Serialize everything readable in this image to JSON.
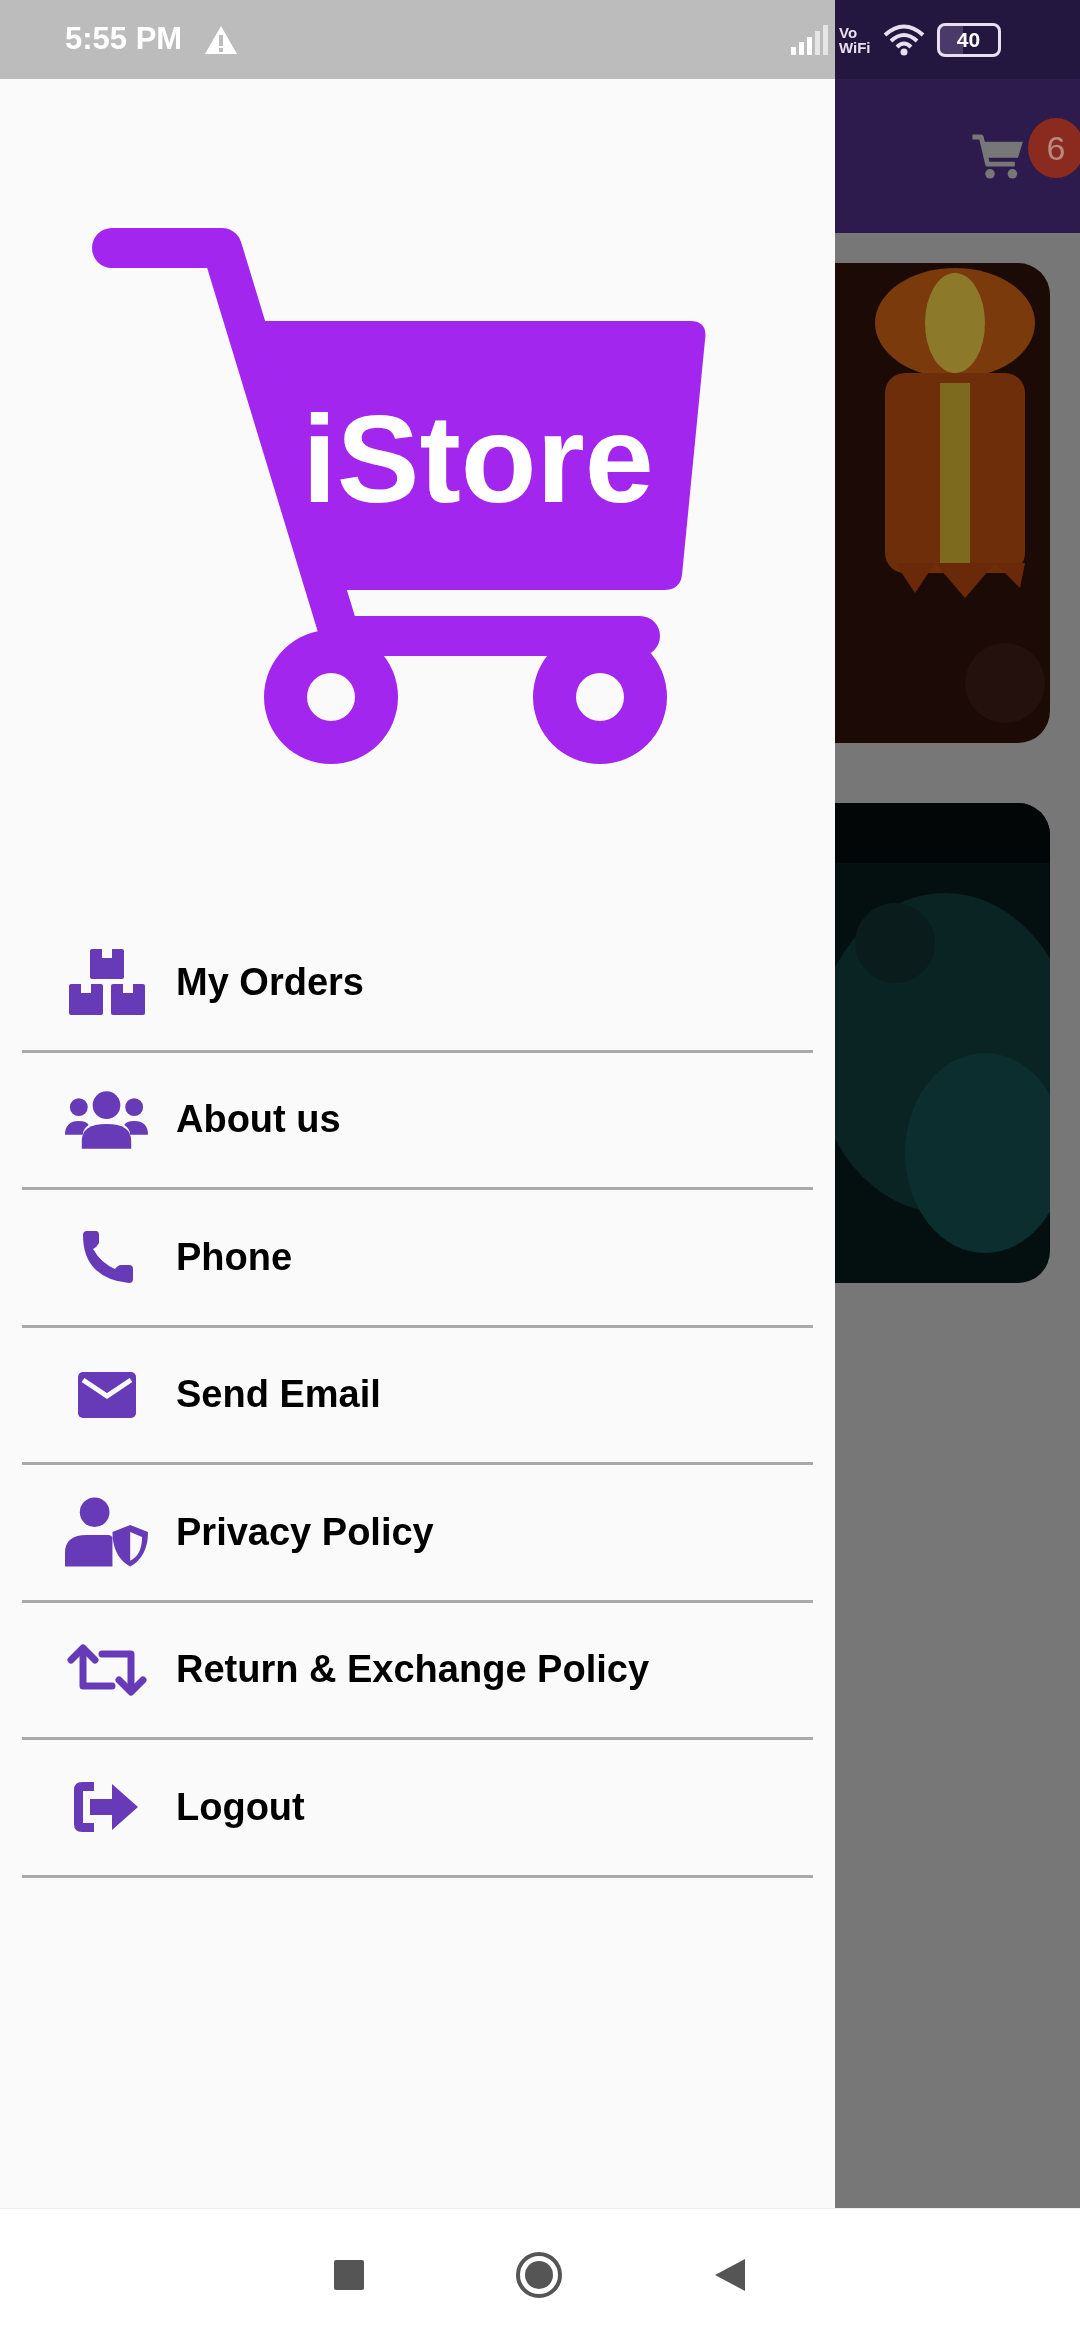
{
  "status_bar": {
    "time": "5:55 PM",
    "vo": "Vo",
    "wifi": "WiFi",
    "battery": "40"
  },
  "app_bar": {
    "cart_badge": "6"
  },
  "drawer": {
    "logo_text": "iStore",
    "items": [
      {
        "label": "My Orders"
      },
      {
        "label": "About us"
      },
      {
        "label": "Phone"
      },
      {
        "label": "Send Email"
      },
      {
        "label": "Privacy Policy"
      },
      {
        "label": "Return & Exchange Policy"
      },
      {
        "label": "Logout"
      }
    ]
  }
}
